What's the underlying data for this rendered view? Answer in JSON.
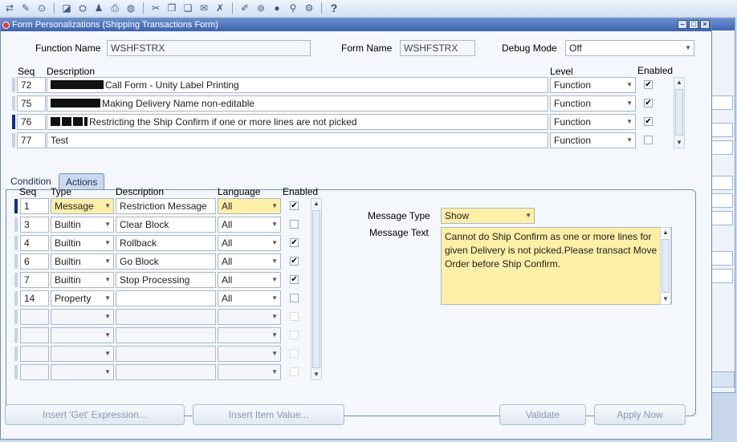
{
  "window": {
    "title": "Form Personalizations (Shipping Transactions Form)"
  },
  "header": {
    "function_name_label": "Function Name",
    "function_name_value": "WSHFSTRX",
    "form_name_label": "Form Name",
    "form_name_value": "WSHFSTRX",
    "debug_mode_label": "Debug Mode",
    "debug_mode_value": "Off"
  },
  "rules": {
    "col_seq": "Seq",
    "col_description": "Description",
    "col_level": "Level",
    "col_enabled": "Enabled",
    "rows": [
      {
        "seq": "72",
        "description": "Call Form - Unity Label Printing",
        "level": "Function",
        "enabled": true
      },
      {
        "seq": "75",
        "description": "Making Delivery Name non-editable",
        "level": "Function",
        "enabled": true
      },
      {
        "seq": "76",
        "description": "Restricting the Ship Confirm if one or more lines are not picked",
        "level": "Function",
        "enabled": true
      },
      {
        "seq": "77",
        "description": "Test",
        "level": "Function",
        "enabled": false
      }
    ]
  },
  "tabs": {
    "condition": "Condition",
    "actions": "Actions"
  },
  "actions": {
    "col_seq": "Seq",
    "col_type": "Type",
    "col_description": "Description",
    "col_language": "Language",
    "col_enabled": "Enabled",
    "rows": [
      {
        "seq": "1",
        "type": "Message",
        "description": "Restriction Message",
        "language": "All",
        "enabled": true
      },
      {
        "seq": "3",
        "type": "Builtin",
        "description": "Clear Block",
        "language": "All",
        "enabled": false
      },
      {
        "seq": "4",
        "type": "Builtin",
        "description": "Rollback",
        "language": "All",
        "enabled": true
      },
      {
        "seq": "6",
        "type": "Builtin",
        "description": "Go Block",
        "language": "All",
        "enabled": true
      },
      {
        "seq": "7",
        "type": "Builtin",
        "description": "Stop Processing",
        "language": "All",
        "enabled": true
      },
      {
        "seq": "14",
        "type": "Property",
        "description": "",
        "language": "All",
        "enabled": false
      }
    ]
  },
  "message": {
    "type_label": "Message Type",
    "type_value": "Show",
    "text_label": "Message Text",
    "text_value": "Cannot do Ship Confirm as one or more lines for given Delivery is not picked.Please transact Move Order before Ship Confirm."
  },
  "buttons": {
    "insert_get": "Insert 'Get' Expression...",
    "insert_item": "Insert Item Value...",
    "validate": "Validate",
    "apply_now": "Apply Now"
  },
  "colors": {
    "title_bar": "#3c63b0",
    "required_field": "#fcefa6",
    "current_record": "#102c8a"
  }
}
